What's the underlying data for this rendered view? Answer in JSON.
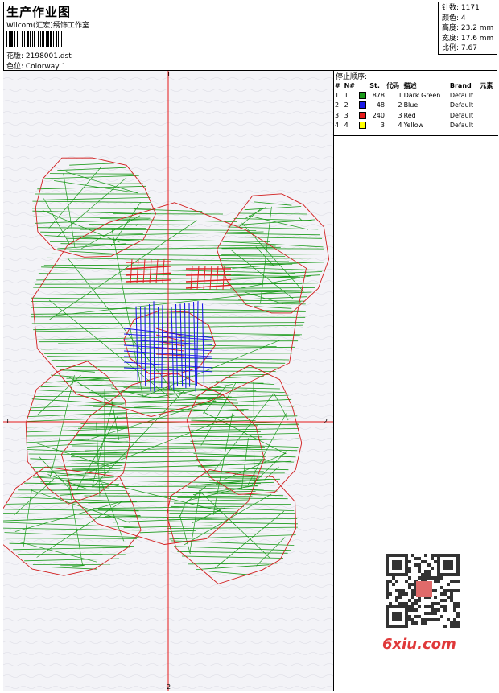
{
  "header": {
    "title": "生产作业图",
    "company": "Wilcom(汇宏)绣饰工作室",
    "design_label": "花版: 2198001.dst",
    "colorway_label": "色位:  Colorway 1"
  },
  "stats": {
    "stitches": "针数: 1171",
    "colors": "颜色: 4",
    "height": "高度: 23.2 mm",
    "width": "宽度: 17.6 mm",
    "scale": "比例: 7.67"
  },
  "stop_sequence": {
    "title": "停止顺序:",
    "headers": [
      "#",
      "N#",
      "St.",
      "代码",
      "描述",
      "Brand",
      "元素"
    ],
    "rows": [
      {
        "idx": "1.",
        "n": "1",
        "color": "#1a9a1a",
        "st": "878",
        "code": "1",
        "desc": "Dark Green",
        "brand": "Default"
      },
      {
        "idx": "2.",
        "n": "2",
        "color": "#1a1ae6",
        "st": "48",
        "code": "2",
        "desc": "Blue",
        "brand": "Default"
      },
      {
        "idx": "3.",
        "n": "3",
        "color": "#e61a1a",
        "st": "240",
        "code": "3",
        "desc": "Red",
        "brand": "Default"
      },
      {
        "idx": "4.",
        "n": "4",
        "color": "#ffff00",
        "st": "3",
        "code": "4",
        "desc": "Yellow",
        "brand": "Default"
      }
    ]
  },
  "canvas": {
    "axis_labels": {
      "top": "1",
      "left": "1",
      "right": "2",
      "bottom": "2"
    },
    "axis_color": "#e61a1a",
    "stitch_green": "#1a9a1a",
    "stitch_red": "#dd2222",
    "stitch_blue": "#1a1ae6",
    "outline_red": "#d21e1e"
  },
  "watermark": {
    "text": "6xiu.com"
  }
}
